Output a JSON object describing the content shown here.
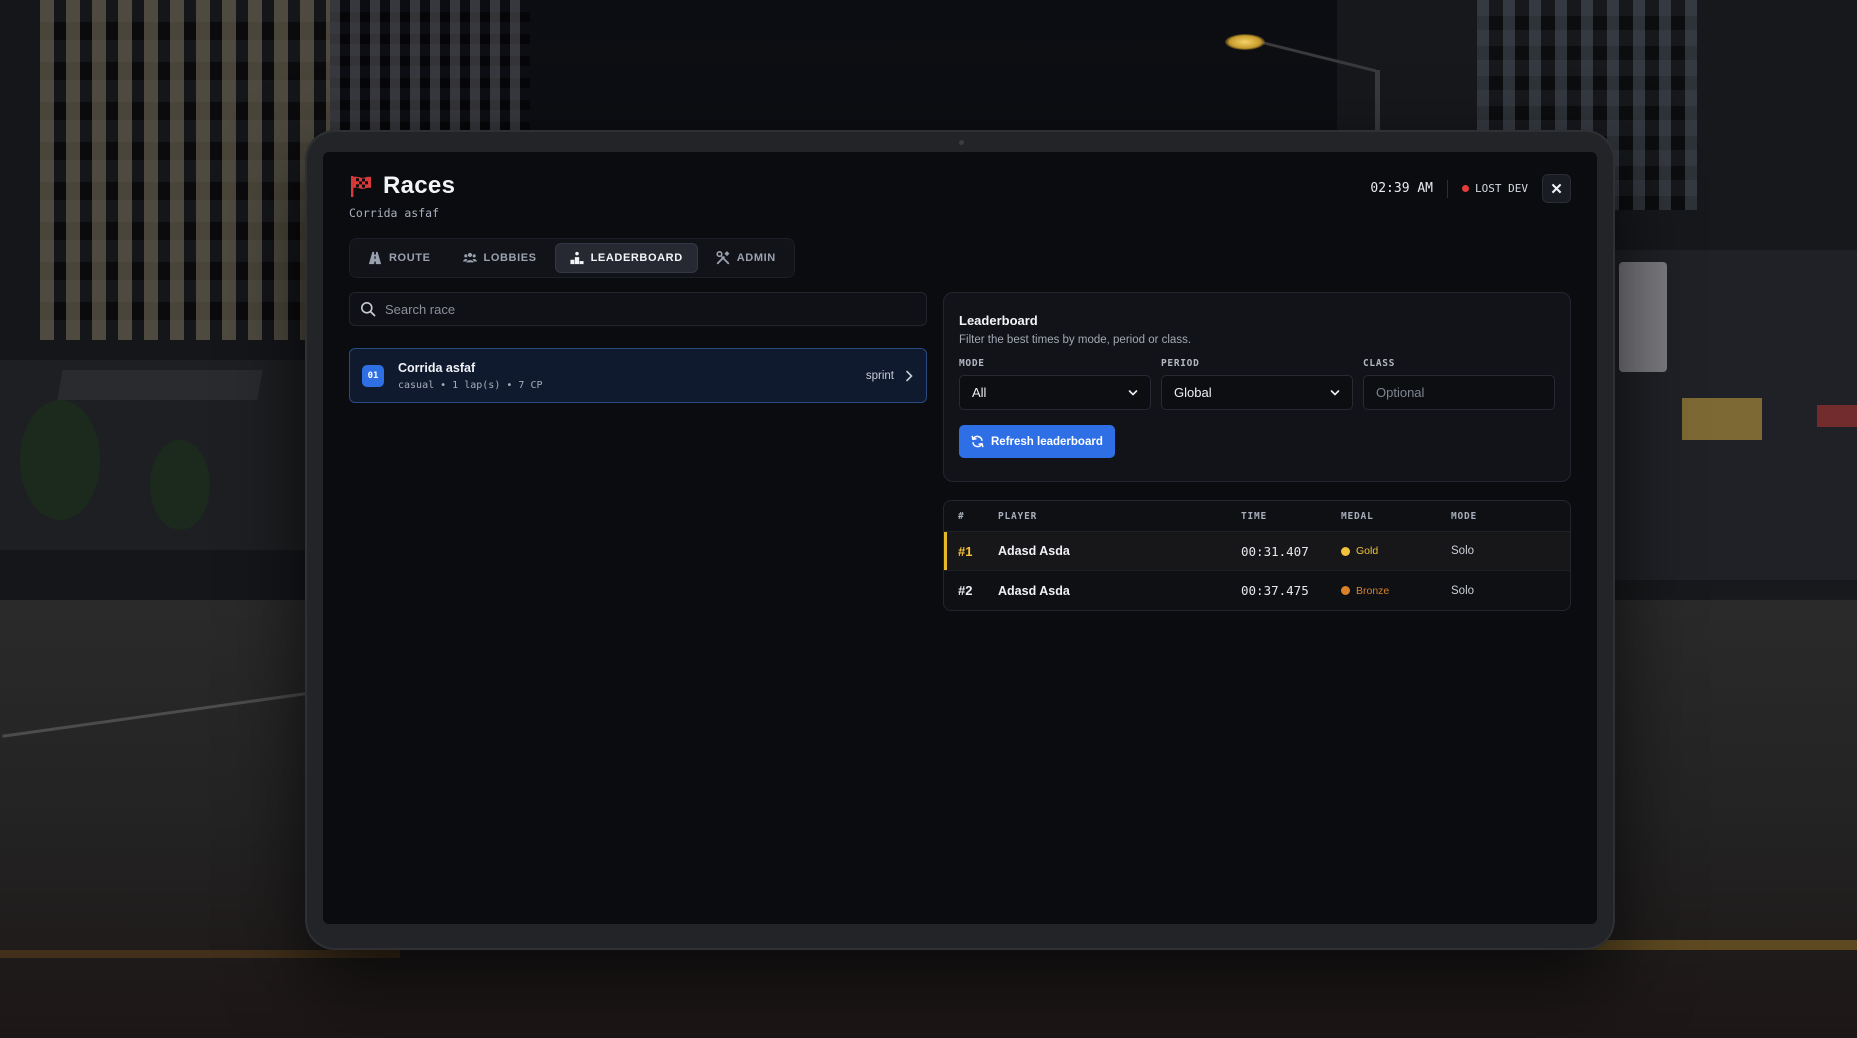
{
  "app": {
    "title": "Races",
    "subtitle": "Corrida asfaf",
    "clock": "02:39 AM",
    "status_label": "LOST DEV",
    "close_glyph": "✕"
  },
  "tabs": [
    {
      "label": "ROUTE",
      "icon": "road-icon",
      "active": false
    },
    {
      "label": "LOBBIES",
      "icon": "users-icon",
      "active": false
    },
    {
      "label": "LEADERBOARD",
      "icon": "podium-icon",
      "active": true
    },
    {
      "label": "ADMIN",
      "icon": "tools-icon",
      "active": false
    }
  ],
  "search": {
    "placeholder": "Search race",
    "value": ""
  },
  "races": [
    {
      "number": "01",
      "name": "Corrida asfaf",
      "meta": "casual • 1 lap(s) • 7 CP",
      "type": "sprint"
    }
  ],
  "leaderboard": {
    "title": "Leaderboard",
    "description": "Filter the best times by mode, period or class.",
    "filters": {
      "mode": {
        "label": "MODE",
        "value": "All"
      },
      "period": {
        "label": "PERIOD",
        "value": "Global"
      },
      "class": {
        "label": "CLASS",
        "placeholder": "Optional",
        "value": ""
      }
    },
    "refresh_label": "Refresh leaderboard",
    "columns": [
      "#",
      "PLAYER",
      "TIME",
      "MEDAL",
      "MODE"
    ],
    "rows": [
      {
        "rank": "#1",
        "player": "Adasd Asda",
        "time": "00:31.407",
        "medal": "Gold",
        "mode": "Solo"
      },
      {
        "rank": "#2",
        "player": "Adasd Asda",
        "time": "00:37.475",
        "medal": "Bronze",
        "mode": "Solo"
      }
    ]
  },
  "colors": {
    "accent": "#2e6fe6",
    "flag_red": "#d83a3a",
    "status_dot": "#e53b3b",
    "gold": "#f2c23a",
    "bronze": "#d9822b"
  }
}
